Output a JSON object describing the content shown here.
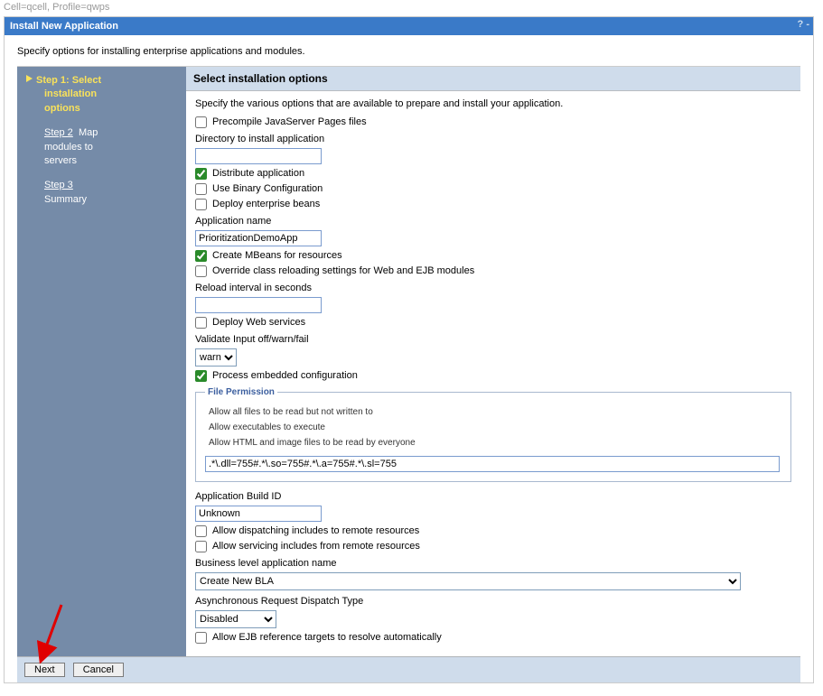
{
  "breadcrumb": "Cell=qcell, Profile=qwps",
  "title": "Install New Application",
  "intro": "Specify options for installing enterprise applications and modules.",
  "side": {
    "step1_a": "Step 1: Select",
    "step1_b": "installation",
    "step1_c": "options",
    "step2_link": "Step 2",
    "step2_tail1": "Map",
    "step2_tail2": "modules to",
    "step2_tail3": "servers",
    "step3_link": "Step 3",
    "step3_tail": "Summary"
  },
  "section_title": "Select installation options",
  "desc": "Specify the various options that are available to prepare and install your application.",
  "labels": {
    "precompile": "Precompile JavaServer Pages files",
    "dirInstall": "Directory to install application",
    "distribute": "Distribute application",
    "useBinary": "Use Binary Configuration",
    "deployEjb": "Deploy enterprise beans",
    "appName": "Application name",
    "createMBeans": "Create MBeans for resources",
    "overrideReload": "Override class reloading settings for Web and EJB modules",
    "reloadInterval": "Reload interval in seconds",
    "deployWS": "Deploy Web services",
    "validate": "Validate Input off/warn/fail",
    "processEmbedded": "Process embedded configuration",
    "filePerm": "File Permission",
    "fpOpt1": "Allow all files to be read but not written to",
    "fpOpt2": "Allow executables to execute",
    "fpOpt3": "Allow HTML and image files to be read by everyone",
    "appBuildId": "Application Build ID",
    "allowDispatch": "Allow dispatching includes to remote resources",
    "allowServicing": "Allow servicing includes from remote resources",
    "blaName": "Business level application name",
    "asyncDispatch": "Asynchronous Request Dispatch Type",
    "allowEjbRef": "Allow EJB reference targets to resolve automatically"
  },
  "values": {
    "dirInstall": "",
    "appName": "PrioritizationDemoApp",
    "reloadInterval": "",
    "validate": "warn",
    "filePermString": ".*\\.dll=755#.*\\.so=755#.*\\.a=755#.*\\.sl=755",
    "appBuildId": "Unknown",
    "bla": "Create New BLA",
    "asyncDispatch": "Disabled"
  },
  "buttons": {
    "next": "Next",
    "cancel": "Cancel"
  },
  "help": "?  -"
}
